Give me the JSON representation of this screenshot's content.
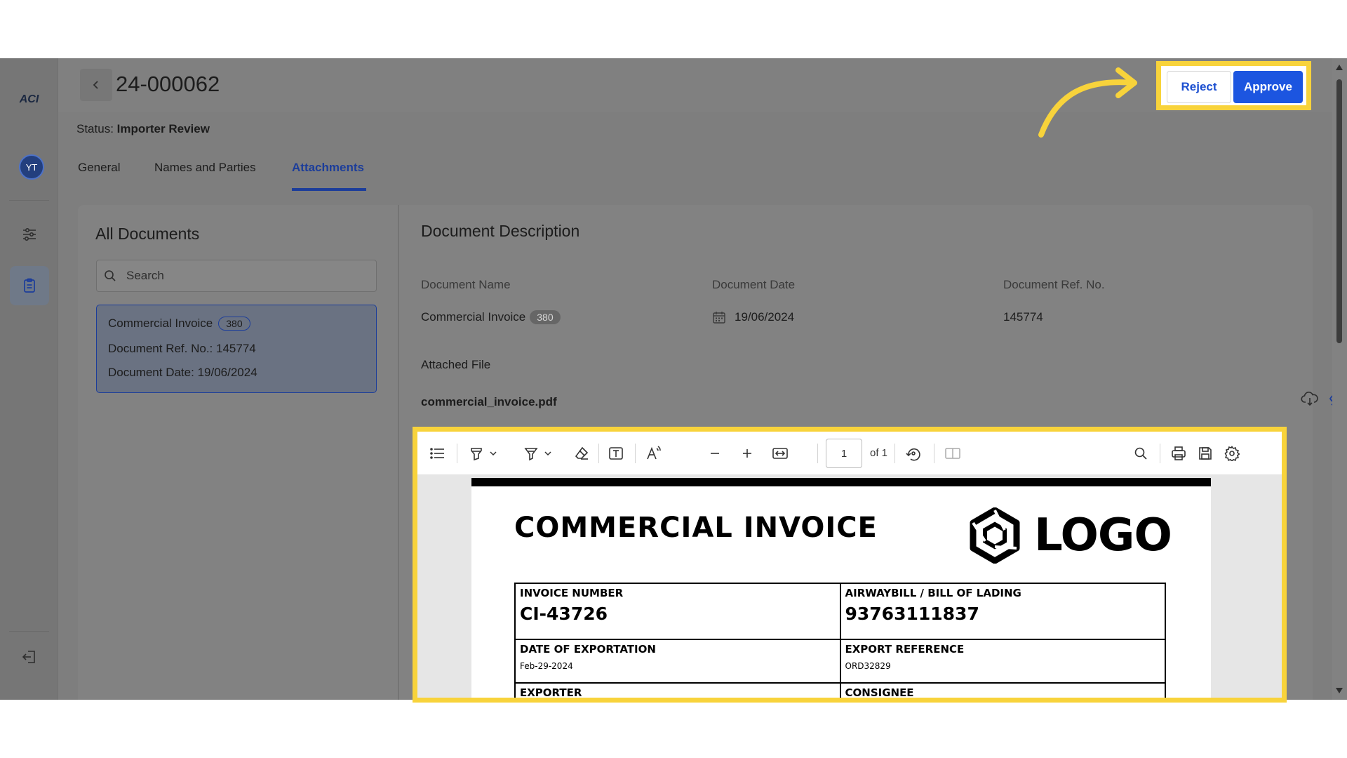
{
  "sidebar": {
    "brand": "ACI",
    "avatar_initials": "YT",
    "items": [
      {
        "name": "filters-icon"
      },
      {
        "name": "clipboard-icon"
      },
      {
        "name": "logout-icon"
      }
    ]
  },
  "header": {
    "title": "24-000062",
    "status_label": "Status:",
    "status_value": "Importer Review",
    "reject_label": "Reject",
    "approve_label": "Approve"
  },
  "tabs": [
    {
      "label": "General",
      "active": false
    },
    {
      "label": "Names and Parties",
      "active": false
    },
    {
      "label": "Attachments",
      "active": true
    }
  ],
  "all_documents": {
    "title": "All Documents",
    "search_placeholder": "Search",
    "items": [
      {
        "name": "Commercial Invoice",
        "code": "380",
        "ref_label": "Document Ref. No.:",
        "ref_value": "145774",
        "date_label": "Document Date:",
        "date_value": "19/06/2024"
      }
    ]
  },
  "document_description": {
    "title": "Document Description",
    "name_label": "Document Name",
    "name_value": "Commercial Invoice",
    "name_code": "380",
    "date_label": "Document Date",
    "date_value": "19/06/2024",
    "ref_label": "Document Ref. No.",
    "ref_value": "145774",
    "attached_label": "Attached File",
    "file_name": "commercial_invoice.pdf"
  },
  "viewer": {
    "page_current": "1",
    "page_total": "of 1"
  },
  "invoice": {
    "title": "COMMERCIAL INVOICE",
    "logo_text": "LOGO",
    "invoice_number_label": "INVOICE NUMBER",
    "invoice_number": "CI-43726",
    "awb_label": "AIRWAYBILL / BILL OF LADING",
    "awb_value": "93763111837",
    "export_date_label": "DATE OF EXPORTATION",
    "export_date": "Feb-29-2024",
    "export_ref_label": "EXPORT REFERENCE",
    "export_ref": "ORD32829",
    "exporter_label": "EXPORTER",
    "consignee_label": "CONSIGNEE"
  },
  "colors": {
    "accent": "#1c3d9a",
    "approve": "#1c55e0",
    "highlight": "#f8d33b",
    "overlay": "#7e7e7e"
  }
}
